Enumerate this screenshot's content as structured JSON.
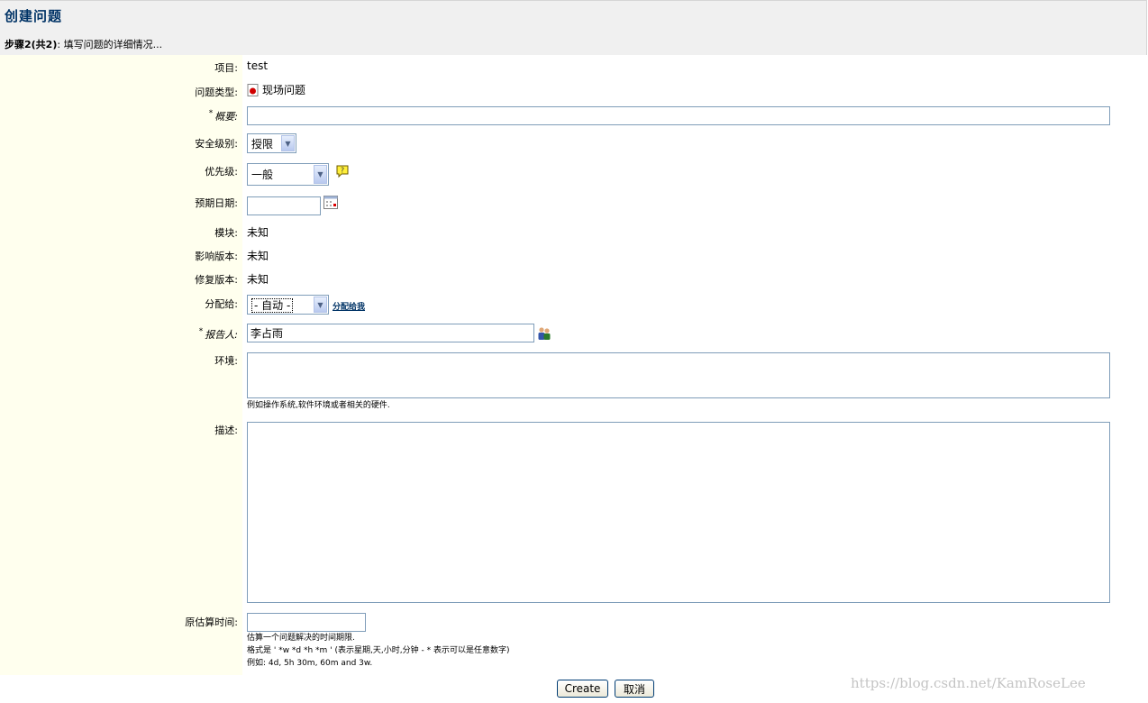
{
  "header": {
    "title": "创建问题",
    "step_bold": "步骤2(共2)",
    "step_text": ": 填写问题的详细情况..."
  },
  "fields": {
    "project": {
      "label": "项目:",
      "value": "test"
    },
    "issue_type": {
      "label": "问题类型:",
      "value": "现场问题"
    },
    "summary": {
      "label": "概要:",
      "value": ""
    },
    "security": {
      "label": "安全级别:",
      "selected": "授限"
    },
    "priority": {
      "label": "优先级:",
      "selected": "一般"
    },
    "due_date": {
      "label": "预期日期:",
      "value": ""
    },
    "component": {
      "label": "模块:",
      "value": "未知"
    },
    "affects_version": {
      "label": "影响版本:",
      "value": "未知"
    },
    "fix_version": {
      "label": "修复版本:",
      "value": "未知"
    },
    "assignee": {
      "label": "分配给:",
      "selected": "- 自动 -",
      "link": "分配给我"
    },
    "reporter": {
      "label": "报告人:",
      "value": "李占雨"
    },
    "environment": {
      "label": "环境:",
      "hint": "例如操作系统,软件环境或者相关的硬件."
    },
    "description": {
      "label": "描述:"
    },
    "estimate": {
      "label": "原估算时间:",
      "hint1": "估算一个问题解决的时间期限.",
      "hint2": "格式是 ' *w *d *h *m ' (表示星期,天,小时,分钟 - * 表示可以是任意数字)",
      "hint3": "例如: 4d, 5h 30m, 60m and 3w."
    }
  },
  "buttons": {
    "create": "Create",
    "cancel": "取消"
  },
  "watermark": "https://blog.csdn.net/KamRoseLee",
  "colors": {
    "header_bg": "#f0f0f0",
    "label_col_bg": "#ffffee",
    "title": "#003366",
    "border": "#7f9db9"
  }
}
